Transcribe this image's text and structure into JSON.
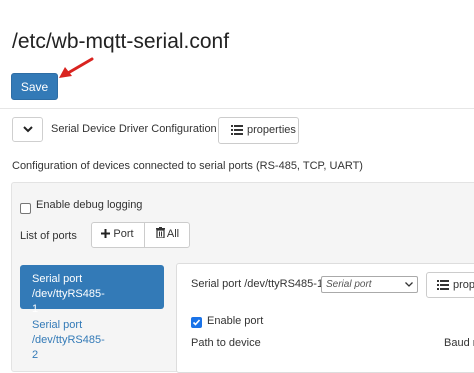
{
  "page": {
    "title": "/etc/wb-mqtt-serial.conf",
    "save_label": "Save"
  },
  "config": {
    "driver_label": "Serial Device Driver Configuration",
    "properties_label": "properties",
    "description": "Configuration of devices connected to serial ports (RS-485, TCP, UART)",
    "debug": {
      "label": "Enable debug logging",
      "checked": false
    },
    "ports_label": "List of ports",
    "add_port_label": "Port",
    "all_label": "All",
    "ports": [
      {
        "line1": "Serial port /dev/ttyRS485-",
        "line2": "1",
        "active": true
      },
      {
        "line1": "Serial port /dev/ttyRS485-",
        "line2": "2",
        "active": false
      }
    ],
    "selected_port": {
      "title": "Serial port /dev/ttyRS485-1",
      "type_value": "Serial port",
      "properties_label": "prope",
      "enable_label": "Enable port",
      "enabled": true,
      "path_label": "Path to device",
      "baud_label": "Baud r"
    }
  },
  "colors": {
    "primary": "#337ab7",
    "arrow": "#d9231f",
    "checkbox_checked": "#1a73e8"
  },
  "icons": {
    "arrow": "red-pointer-arrow",
    "collapse": "chevron-down-icon",
    "list": "list-icon",
    "plus": "plus-icon",
    "trash": "trash-icon",
    "check": "check-icon"
  }
}
